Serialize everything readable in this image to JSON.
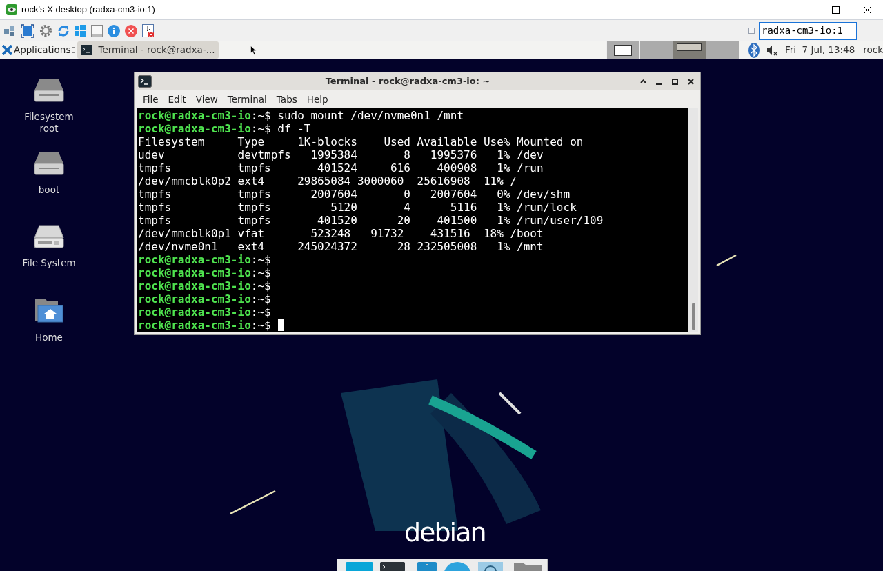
{
  "viewer": {
    "title": "rock's X desktop (radxa-cm3-io:1)",
    "host_field": "radxa-cm3-io:1",
    "checked": false
  },
  "panel": {
    "applications": "Applications",
    "tasks": [
      {
        "label": "Terminal - rock@radxa-...",
        "selected": true
      }
    ],
    "workspaces": [
      {
        "selected": false,
        "has_window": true
      },
      {
        "selected": false,
        "has_window": false
      },
      {
        "selected": true,
        "has_window": true
      },
      {
        "selected": false,
        "has_window": false
      }
    ],
    "clock": "Fri  7 Jul, 13:48",
    "user": "rock"
  },
  "desktop_icons": [
    {
      "label": "Filesystem root",
      "kind": "drive"
    },
    {
      "label": "boot",
      "kind": "drive"
    },
    {
      "label": "File System",
      "kind": "harddisk"
    },
    {
      "label": "Home",
      "kind": "home"
    }
  ],
  "terminal": {
    "title": "Terminal - rock@radxa-cm3-io: ~",
    "menu": [
      "File",
      "Edit",
      "View",
      "Terminal",
      "Tabs",
      "Help"
    ],
    "lines": [
      {
        "kind": "prompt",
        "user": "rock@radxa-cm3-io",
        "path": ":~$",
        "command": " sudo mount /dev/nvme0n1 /mnt",
        "cursor": false
      },
      {
        "kind": "prompt",
        "user": "rock@radxa-cm3-io",
        "path": ":~$",
        "command": " df -T",
        "cursor": false
      },
      {
        "kind": "output",
        "text": "Filesystem     Type     1K-blocks    Used Available Use% Mounted on"
      },
      {
        "kind": "output",
        "text": "udev           devtmpfs   1995384       8   1995376   1% /dev"
      },
      {
        "kind": "output",
        "text": "tmpfs          tmpfs       401524     616    400908   1% /run"
      },
      {
        "kind": "output",
        "text": "/dev/mmcblk0p2 ext4     29865084 3000060  25616908  11% /"
      },
      {
        "kind": "output",
        "text": "tmpfs          tmpfs      2007604       0   2007604   0% /dev/shm"
      },
      {
        "kind": "output",
        "text": "tmpfs          tmpfs         5120       4      5116   1% /run/lock"
      },
      {
        "kind": "output",
        "text": "tmpfs          tmpfs       401520      20    401500   1% /run/user/109"
      },
      {
        "kind": "output",
        "text": "/dev/mmcblk0p1 vfat       523248   91732    431516  18% /boot"
      },
      {
        "kind": "output",
        "text": "/dev/nvme0n1   ext4     245024372      28 232505008   1% /mnt"
      },
      {
        "kind": "prompt",
        "user": "rock@radxa-cm3-io",
        "path": ":~$",
        "cursor": false
      },
      {
        "kind": "prompt",
        "user": "rock@radxa-cm3-io",
        "path": ":~$",
        "cursor": false
      },
      {
        "kind": "prompt",
        "user": "rock@radxa-cm3-io",
        "path": ":~$",
        "cursor": false
      },
      {
        "kind": "prompt",
        "user": "rock@radxa-cm3-io",
        "path": ":~$",
        "cursor": false
      },
      {
        "kind": "prompt",
        "user": "rock@radxa-cm3-io",
        "path": ":~$",
        "cursor": false
      },
      {
        "kind": "prompt",
        "user": "rock@radxa-cm3-io",
        "path": ":~$",
        "cursor": true
      }
    ]
  },
  "wallpaper": {
    "logo": "debian"
  }
}
